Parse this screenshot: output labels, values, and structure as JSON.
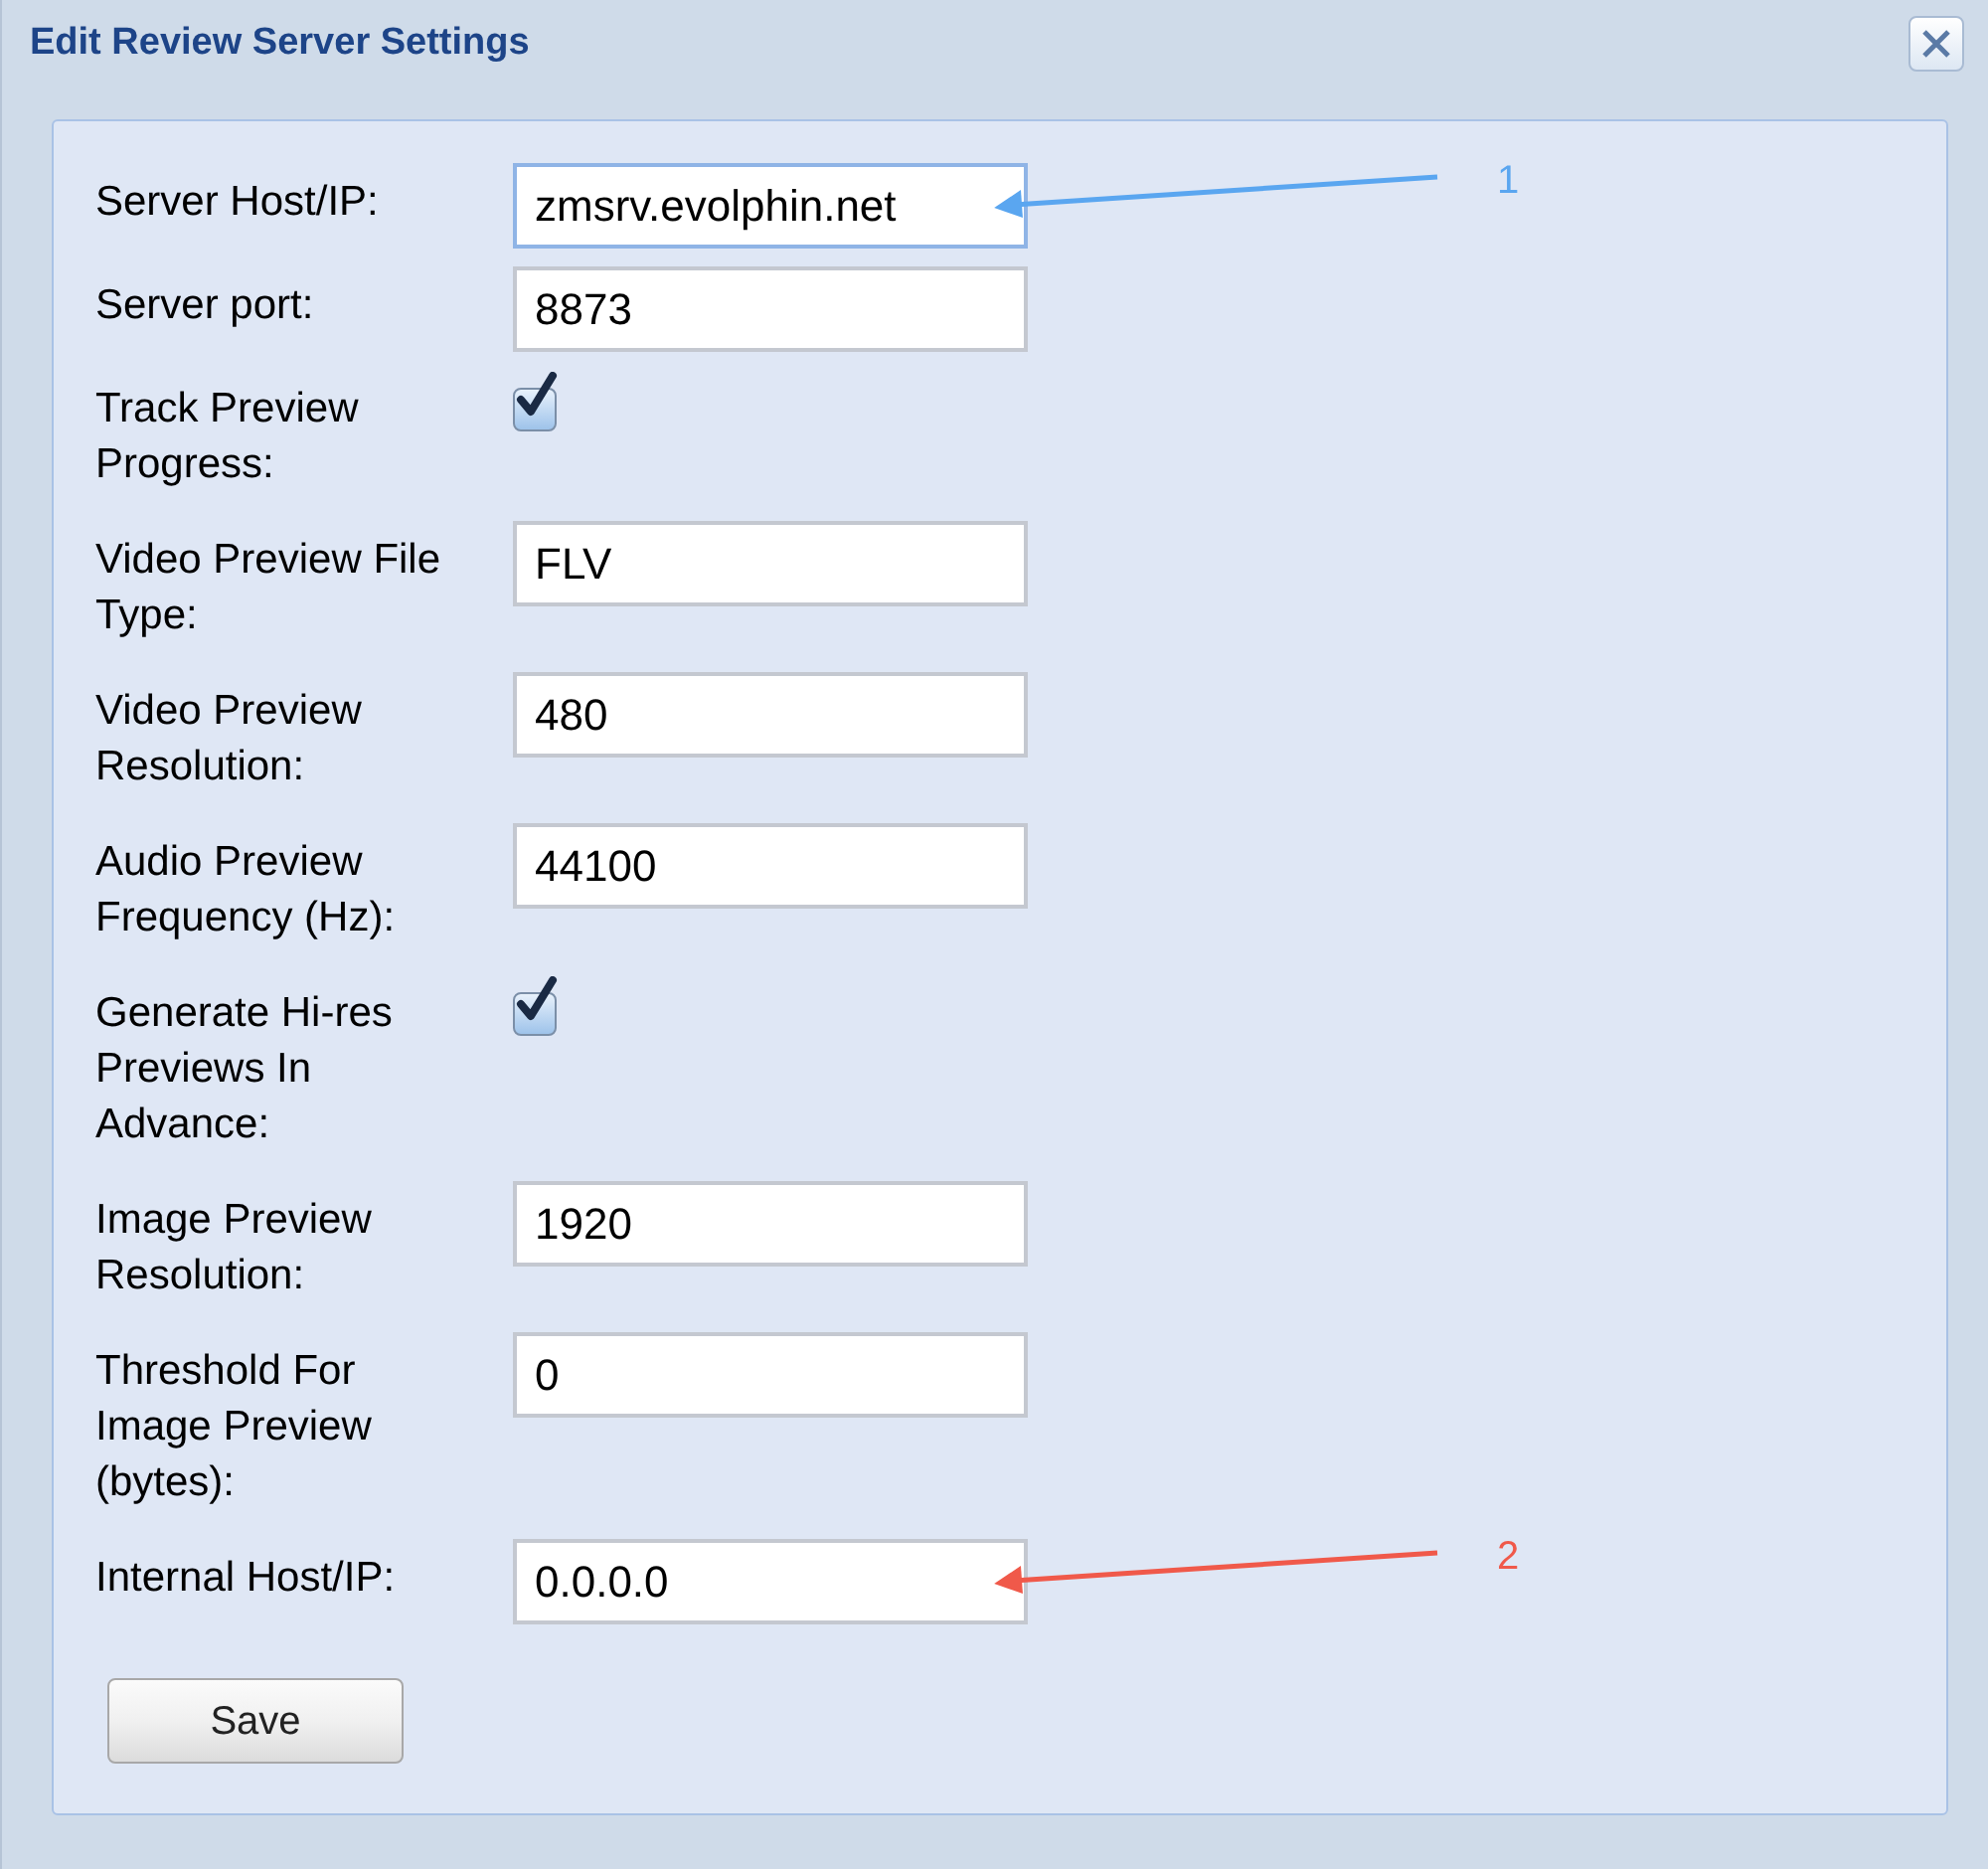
{
  "window": {
    "title": "Edit Review Server Settings"
  },
  "fields": [
    {
      "kind": "text",
      "label": "Server Host/IP:",
      "value": "zmsrv.evolphin.net",
      "focused": true,
      "annotation": {
        "label": "1",
        "color": "#5aa6f0"
      }
    },
    {
      "kind": "text",
      "label": "Server port:",
      "value": "8873",
      "focused": false
    },
    {
      "kind": "checkbox",
      "label": "Track Preview Progress:",
      "checked": true
    },
    {
      "kind": "text",
      "label": "Video Preview File Type:",
      "value": "FLV",
      "focused": false
    },
    {
      "kind": "text",
      "label": "Video Preview Resolution:",
      "value": "480",
      "focused": false
    },
    {
      "kind": "text",
      "label": "Audio Preview Frequency (Hz):",
      "value": "44100",
      "focused": false
    },
    {
      "kind": "checkbox",
      "label": "Generate Hi-res Previews In Advance:",
      "checked": true
    },
    {
      "kind": "text",
      "label": "Image Preview Resolution:",
      "value": "1920",
      "focused": false
    },
    {
      "kind": "text",
      "label": "Threshold For Image Preview (bytes):",
      "value": "0",
      "focused": false
    },
    {
      "kind": "text",
      "label": "Internal Host/IP:",
      "value": "0.0.0.0",
      "focused": false,
      "annotation": {
        "label": "2",
        "color": "#f0594a"
      }
    }
  ],
  "save_button": "Save"
}
